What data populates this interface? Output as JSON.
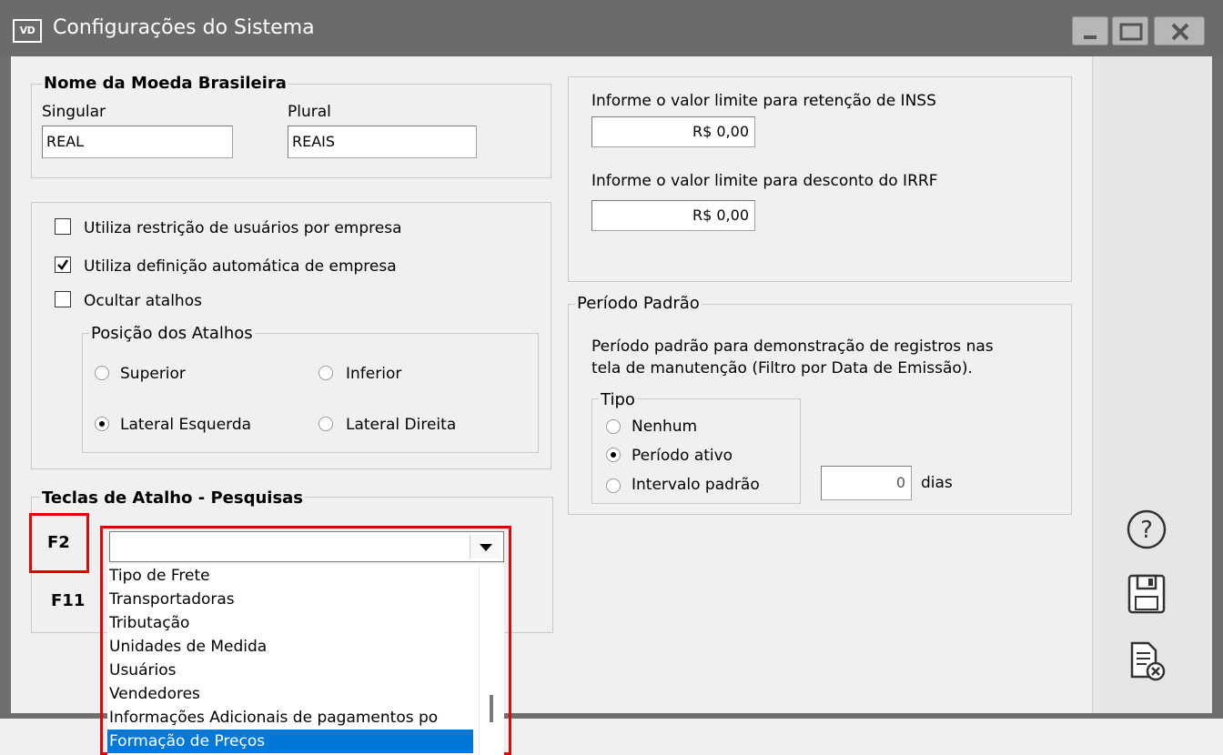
{
  "window": {
    "app_badge": "VD",
    "title": "Configurações do Sistema"
  },
  "currency_group": {
    "title": "Nome da Moeda Brasileira",
    "singular_label": "Singular",
    "singular_value": "REAL",
    "plural_label": "Plural",
    "plural_value": "REAIS"
  },
  "options_group": {
    "checkboxes": [
      {
        "label": "Utiliza restrição de usuários por empresa",
        "checked": false
      },
      {
        "label": "Utiliza definição automática de empresa",
        "checked": true
      },
      {
        "label": "Ocultar atalhos",
        "checked": false
      }
    ],
    "shortcut_position": {
      "title": "Posição dos Atalhos",
      "options": [
        {
          "label": "Superior",
          "selected": false
        },
        {
          "label": "Inferior",
          "selected": false
        },
        {
          "label": "Lateral Esquerda",
          "selected": true
        },
        {
          "label": "Lateral Direita",
          "selected": false
        }
      ]
    }
  },
  "limits_group": {
    "inss_label": "Informe o valor limite para retenção de INSS",
    "inss_value": "R$ 0,00",
    "irrf_label": "Informe o valor limite para desconto do IRRF",
    "irrf_value": "R$ 0,00"
  },
  "period_group": {
    "title": "Período Padrão",
    "description_line1": "Período padrão para demonstração de registros nas",
    "description_line2": "tela de manutenção (Filtro por Data de Emissão).",
    "type": {
      "title": "Tipo",
      "options": [
        {
          "label": "Nenhum",
          "selected": false
        },
        {
          "label": "Período ativo",
          "selected": true
        },
        {
          "label": "Intervalo padrão",
          "selected": false
        }
      ],
      "interval_value": "0",
      "interval_unit": "dias"
    }
  },
  "shortcuts_group": {
    "title": "Teclas de Atalho - Pesquisas",
    "f2_label": "F2",
    "f11_label": "F11",
    "combo_value": "",
    "dropdown_items": [
      "Tipo de Frete",
      "Transportadoras",
      "Tributação",
      "Unidades de Medida",
      "Usuários",
      "Vendedores",
      "Informações Adicionais de pagamentos po",
      "Formação de Preços"
    ],
    "selected_index": 7
  },
  "toolbar": {
    "icons": [
      "help-icon",
      "save-icon",
      "cancel-document-icon"
    ]
  },
  "colors": {
    "titlebar": "#6b6b6b",
    "highlight": "#e00000",
    "selection": "#0078d7"
  }
}
